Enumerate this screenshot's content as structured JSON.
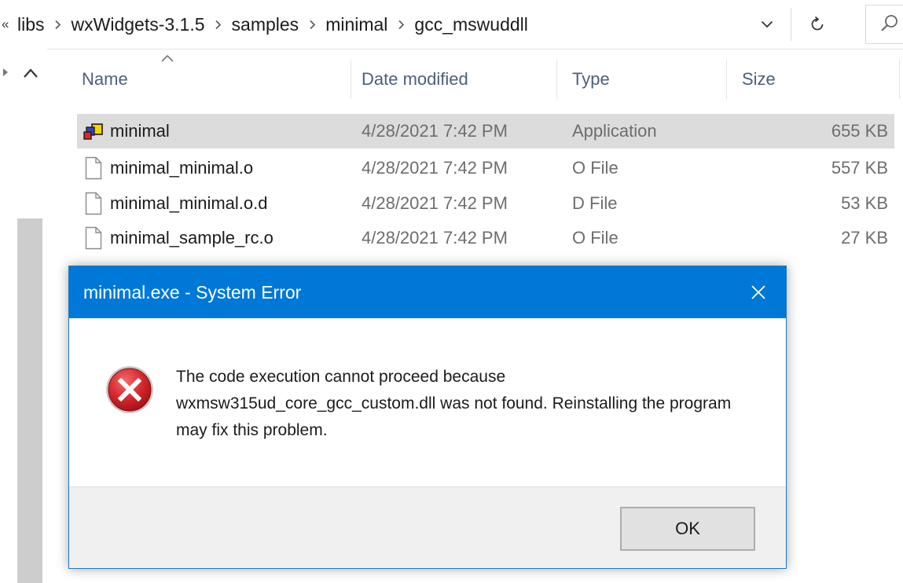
{
  "breadcrumb": {
    "lead": "«",
    "segments": [
      "libs",
      "wxWidgets-3.1.5",
      "samples",
      "minimal",
      "gcc_mswuddll"
    ]
  },
  "columns": {
    "name": "Name",
    "date": "Date modified",
    "type": "Type",
    "size": "Size"
  },
  "files": [
    {
      "name": "minimal",
      "date": "4/28/2021 7:42 PM",
      "type": "Application",
      "size": "655 KB",
      "icon": "application-icon",
      "selected": true
    },
    {
      "name": "minimal_minimal.o",
      "date": "4/28/2021 7:42 PM",
      "type": "O File",
      "size": "557 KB",
      "icon": "file-icon",
      "selected": false
    },
    {
      "name": "minimal_minimal.o.d",
      "date": "4/28/2021 7:42 PM",
      "type": "D File",
      "size": "53 KB",
      "icon": "file-icon",
      "selected": false
    },
    {
      "name": "minimal_sample_rc.o",
      "date": "4/28/2021 7:42 PM",
      "type": "O File",
      "size": "27 KB",
      "icon": "file-icon",
      "selected": false
    }
  ],
  "dialog": {
    "title": "minimal.exe - System Error",
    "message": "The code execution cannot proceed because wxmsw315ud_core_gcc_custom.dll was not found. Reinstalling the program may fix this problem.",
    "ok_label": "OK"
  },
  "colors": {
    "titlebar": "#0078d7",
    "selected_row": "#dcdcdc",
    "error_red": "#d6262c",
    "header_text": "#4c607a"
  }
}
